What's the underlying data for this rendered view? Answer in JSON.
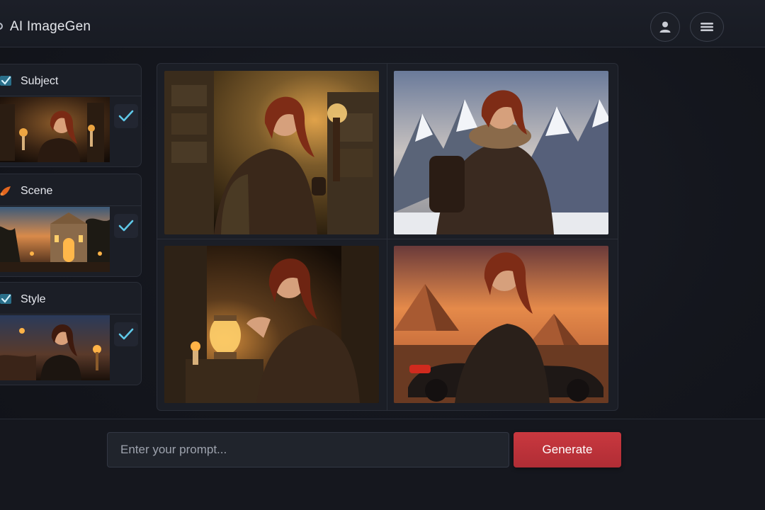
{
  "app": {
    "title": "AI ImageGen"
  },
  "header": {
    "icons": [
      "user-icon",
      "hamburger-menu-icon"
    ]
  },
  "sidebar": {
    "items": [
      {
        "label": "Subject",
        "icon": "checkbox-icon",
        "selected": true,
        "thumbnail": "adventurer-with-candles"
      },
      {
        "label": "Scene",
        "icon": "paint-brush-icon",
        "selected": true,
        "thumbnail": "temple-at-dusk"
      },
      {
        "label": "Style",
        "icon": "checkbox-icon",
        "selected": true,
        "thumbnail": "adventurer-in-cave"
      }
    ]
  },
  "gallery": {
    "images": [
      {
        "subject": "adventurer-with-torch-in-ruins"
      },
      {
        "subject": "adventurer-in-snowy-mountains"
      },
      {
        "subject": "adventurer-with-lantern"
      },
      {
        "subject": "adventurer-at-pyramids-with-motorcycle"
      }
    ]
  },
  "prompt": {
    "placeholder": "Enter your prompt...",
    "value": ""
  },
  "generate": {
    "label": "Generate"
  },
  "colors": {
    "accent": "#c9383f",
    "check": "#5fc8e8",
    "background": "#14161d",
    "panel": "#1b1e26"
  }
}
